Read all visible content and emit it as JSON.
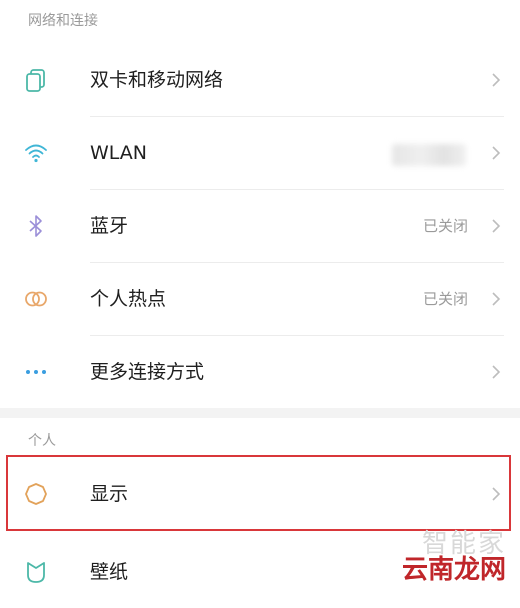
{
  "sections": [
    {
      "header": "网络和连接",
      "items": [
        {
          "label": "双卡和移动网络",
          "value": "",
          "icon": "sim-cards-icon"
        },
        {
          "label": "WLAN",
          "value": "",
          "icon": "wifi-icon"
        },
        {
          "label": "蓝牙",
          "value": "已关闭",
          "icon": "bluetooth-icon"
        },
        {
          "label": "个人热点",
          "value": "已关闭",
          "icon": "hotspot-icon"
        },
        {
          "label": "更多连接方式",
          "value": "",
          "icon": "more-dots-icon"
        }
      ]
    },
    {
      "header": "个人",
      "items": [
        {
          "label": "显示",
          "value": "",
          "icon": "display-brightness-icon"
        },
        {
          "label": "壁纸",
          "value": "",
          "icon": "wallpaper-icon"
        }
      ]
    }
  ],
  "watermark": {
    "top": "智能家",
    "bottom": "云南龙网"
  },
  "colors": {
    "highlight": "#d9373a",
    "icon_teal": "#4cb8a8",
    "icon_wifi": "#3fb6d6",
    "icon_bluetooth": "#9b8fd8",
    "icon_hotspot": "#e8a76a",
    "icon_more": "#3a9ee0",
    "icon_display": "#e2a25a"
  }
}
